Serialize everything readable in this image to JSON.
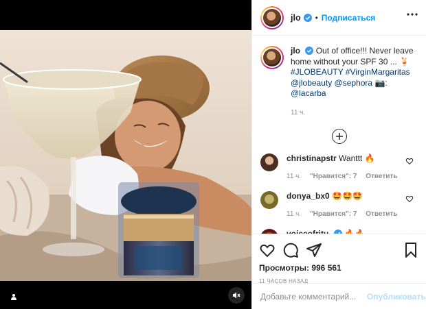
{
  "header": {
    "username": "jlo",
    "dot": "•",
    "follow_label": "Подписаться"
  },
  "caption": {
    "username": "jlo",
    "text": "Out of office!!! Never leave home without your SPF 30 ... 🍹",
    "hashtags": "#JLOBEAUTY #VirginMargaritas",
    "mentions": "@jlobeauty @sephora",
    "credit_prefix": "📷: ",
    "credit": "@lacarba",
    "time": "11 ч."
  },
  "comments": [
    {
      "username": "christinapstr",
      "text": "Wanttt 🔥",
      "time": "11 ч.",
      "likes": "\"Нравится\": 7",
      "reply": "Ответить"
    },
    {
      "username": "donya_bx0",
      "text": "🤩🤩🤩",
      "time": "11 ч.",
      "likes": "\"Нравится\": 7",
      "reply": "Ответить"
    },
    {
      "username": "voiceofritu",
      "text": "🔥🔥",
      "time": "",
      "likes": "",
      "reply": ""
    }
  ],
  "actions": {
    "views_label": "Просмотры: 996 561",
    "ago": "11 ЧАСОВ НАЗАД"
  },
  "add_comment": {
    "placeholder": "Добавьте комментарий...",
    "publish_label": "Опубликовать"
  },
  "colors": {
    "accent": "#0095f6",
    "publish_disabled": "#b2dffc",
    "tag": "#00376b"
  },
  "icons": [
    "user-tag-icon",
    "mute-icon",
    "verified-icon",
    "more-icon",
    "plus-circle-icon",
    "heart-icon",
    "comment-icon",
    "share-icon",
    "bookmark-icon"
  ]
}
